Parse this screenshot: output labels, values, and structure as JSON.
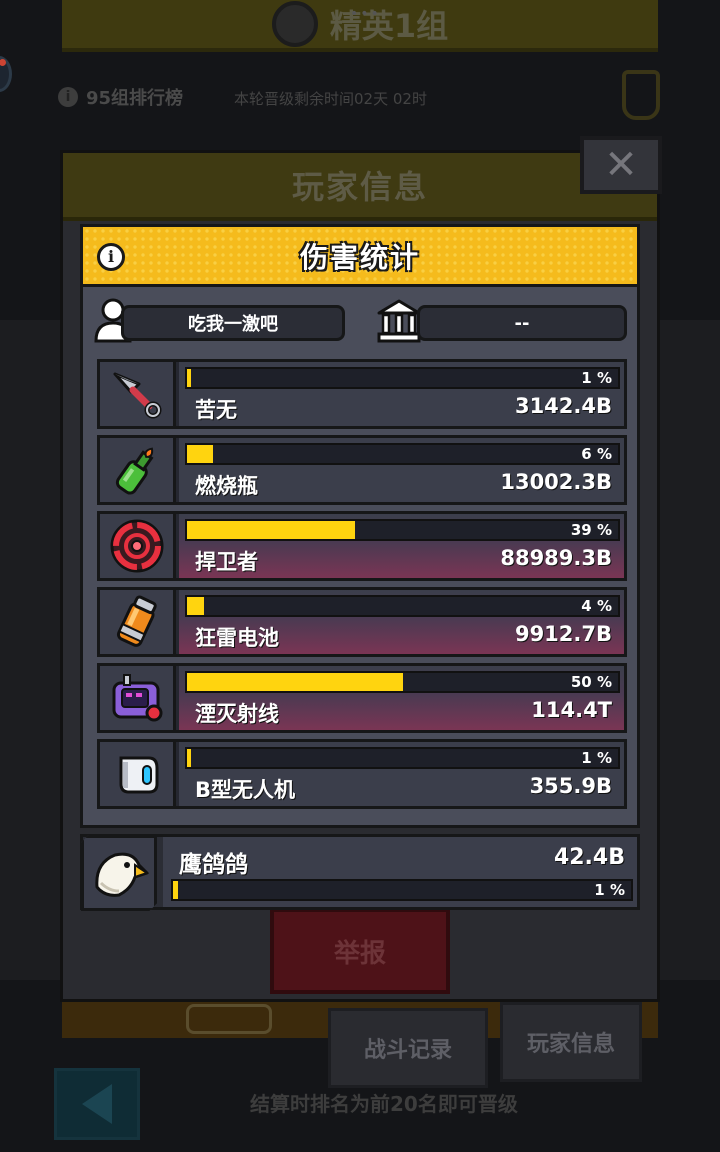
{
  "background": {
    "banner_title": "精英1组",
    "rank_label": "95组排行榜",
    "countdown": "本轮晋级剩余时间02天 02时",
    "tabs": {
      "battle": "战斗记录",
      "player": "玩家信息"
    },
    "promo_text": "结算时排名为前20名即可晋级"
  },
  "dialog": {
    "title": "玩家信息",
    "report_label": "举报",
    "close_icon": "close-x"
  },
  "panel": {
    "title": "伤害统计",
    "player_name": "吃我一激吧",
    "guild_name": "--"
  },
  "skills": [
    {
      "name": "苦无",
      "damage": "3142.4B",
      "percent": 1,
      "percent_label": "1 %",
      "icon": "kunai-icon",
      "highlight": false
    },
    {
      "name": "燃烧瓶",
      "damage": "13002.3B",
      "percent": 6,
      "percent_label": "6 %",
      "icon": "molotov-icon",
      "highlight": false
    },
    {
      "name": "捍卫者",
      "damage": "88989.3B",
      "percent": 39,
      "percent_label": "39 %",
      "icon": "defender-icon",
      "highlight": true
    },
    {
      "name": "狂雷电池",
      "damage": "9912.7B",
      "percent": 4,
      "percent_label": "4 %",
      "icon": "battery-icon",
      "highlight": true
    },
    {
      "name": "湮灭射线",
      "damage": "114.4T",
      "percent": 50,
      "percent_label": "50 %",
      "icon": "ray-device-icon",
      "highlight": true
    },
    {
      "name": "B型无人机",
      "damage": "355.9B",
      "percent": 1,
      "percent_label": "1 %",
      "icon": "drone-icon",
      "highlight": false
    }
  ],
  "pet": {
    "name": "鹰鸽鸽",
    "damage": "42.4B",
    "percent": 1,
    "percent_label": "1 %",
    "icon": "eagle-icon"
  },
  "colors": {
    "accent_yellow": "#f5bb1c",
    "bar_fill": "#ffd40f",
    "highlight_gradient": "#7a3554"
  }
}
